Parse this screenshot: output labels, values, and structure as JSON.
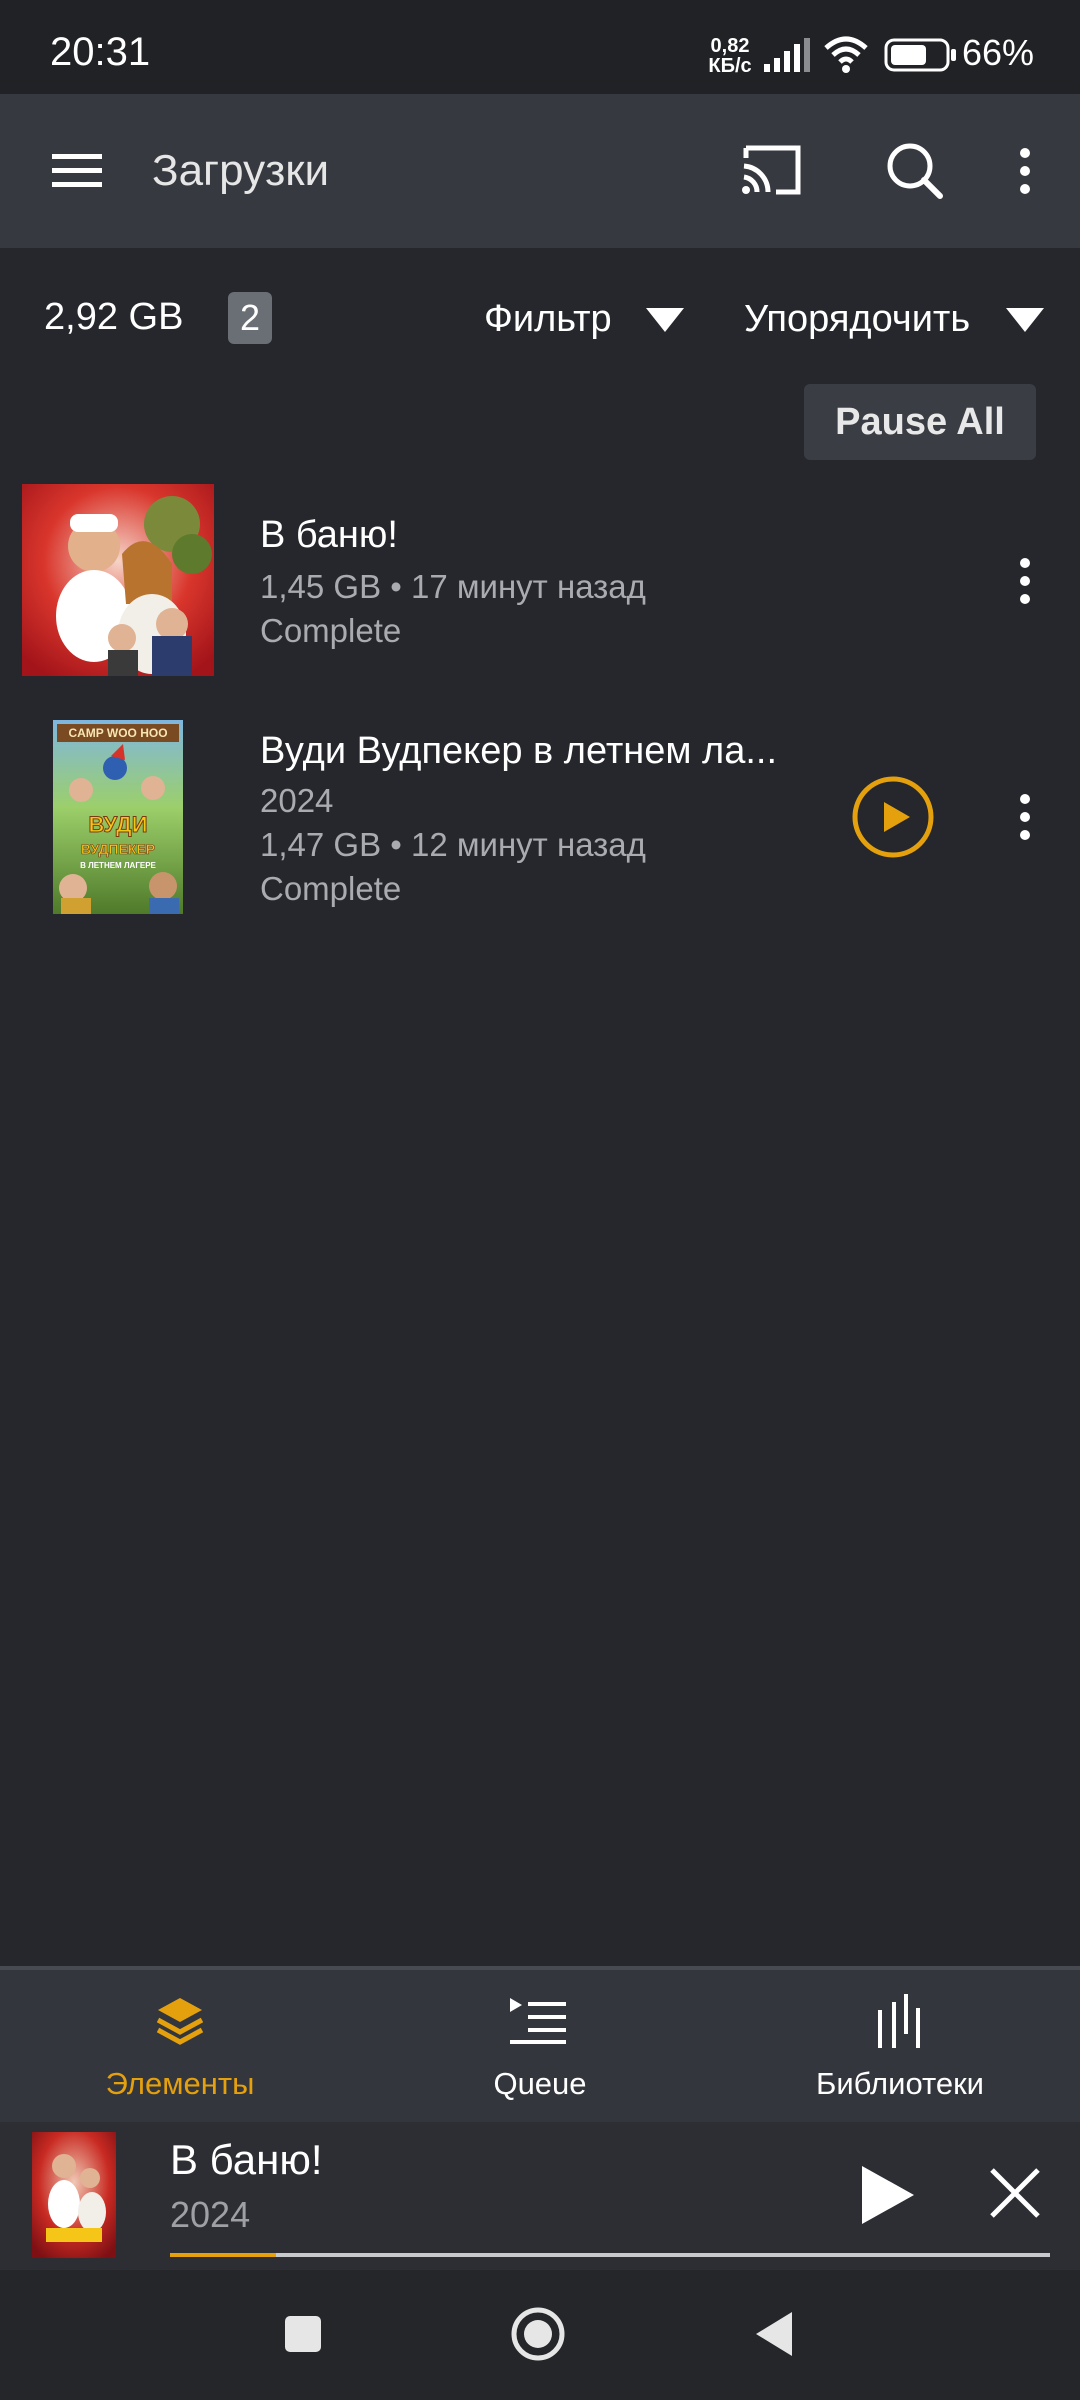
{
  "status_bar": {
    "time": "20:31",
    "net_speed_value": "0,82",
    "net_speed_unit": "КБ/с",
    "battery_percent": "66%",
    "battery_level": 0.66
  },
  "app_bar": {
    "title": "Загрузки",
    "icons": [
      "menu-icon",
      "cast-icon",
      "search-icon",
      "more-vert-icon"
    ]
  },
  "toolbar": {
    "total_size": "2,92 GB",
    "count": "2",
    "filter_label": "Фильтр",
    "sort_label": "Упорядочить",
    "pause_all_label": "Pause All"
  },
  "downloads": [
    {
      "title": "В баню!",
      "meta": "1,45 GB  •  17 минут назад",
      "status": "Complete"
    },
    {
      "title": "Вуди Вудпекер в летнем ла...",
      "year": "2024",
      "meta": "1,47 GB  •  12 минут назад",
      "status": "Complete",
      "poster_text": "CAMP WOO HOO",
      "poster_title": "ВУДИ ВУДПЕКЕР",
      "poster_subtitle": "В ЛЕТНЕМ ЛАГЕРЕ"
    }
  ],
  "bottom_nav": {
    "items": [
      {
        "label": "Элементы",
        "icon": "layers-icon",
        "active": true
      },
      {
        "label": "Queue",
        "icon": "queue-icon",
        "active": false
      },
      {
        "label": "Библиотеки",
        "icon": "libraries-icon",
        "active": false
      }
    ]
  },
  "mini_player": {
    "title": "В баню!",
    "year": "2024",
    "progress": 0.12
  },
  "colors": {
    "accent": "#e5a00d",
    "background": "#25272c",
    "app_bar": "#363940"
  }
}
